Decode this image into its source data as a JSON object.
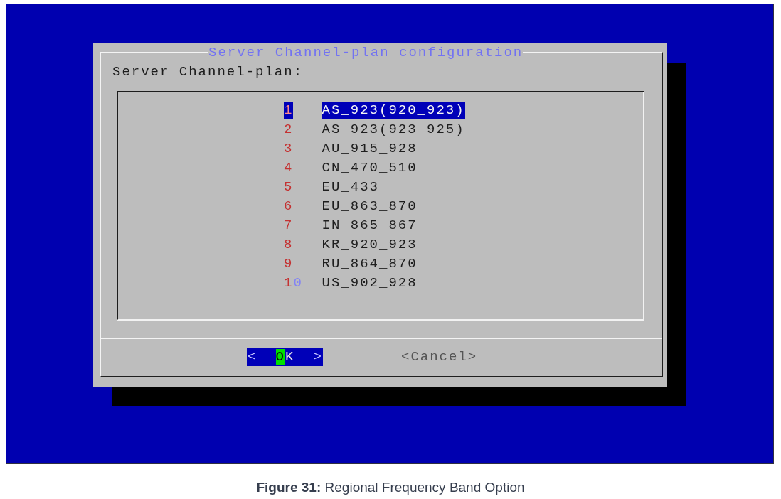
{
  "dialog": {
    "title": "Server Channel-plan configuration",
    "prompt": "Server Channel-plan:",
    "menu": {
      "items": [
        {
          "tag": "1",
          "label": "AS_923(920_923)",
          "selected": true
        },
        {
          "tag": "2",
          "label": "AS_923(923_925)",
          "selected": false
        },
        {
          "tag": "3",
          "label": "AU_915_928",
          "selected": false
        },
        {
          "tag": "4",
          "label": "CN_470_510",
          "selected": false
        },
        {
          "tag": "5",
          "label": "EU_433",
          "selected": false
        },
        {
          "tag": "6",
          "label": "EU_863_870",
          "selected": false
        },
        {
          "tag": "7",
          "label": "IN_865_867",
          "selected": false
        },
        {
          "tag": "8",
          "label": "KR_920_923",
          "selected": false
        },
        {
          "tag": "9",
          "label": "RU_864_870",
          "selected": false
        },
        {
          "tag": "10",
          "label": "US_902_928",
          "selected": false
        }
      ]
    },
    "buttons": [
      {
        "open": "<",
        "label": "OK",
        "close": ">",
        "selected": true,
        "cursor": true
      },
      {
        "open": "<",
        "label": "Cancel",
        "close": ">",
        "selected": false,
        "cursor": false
      }
    ]
  },
  "caption": "**Figure 31:** Regional Frequency Band Option"
}
